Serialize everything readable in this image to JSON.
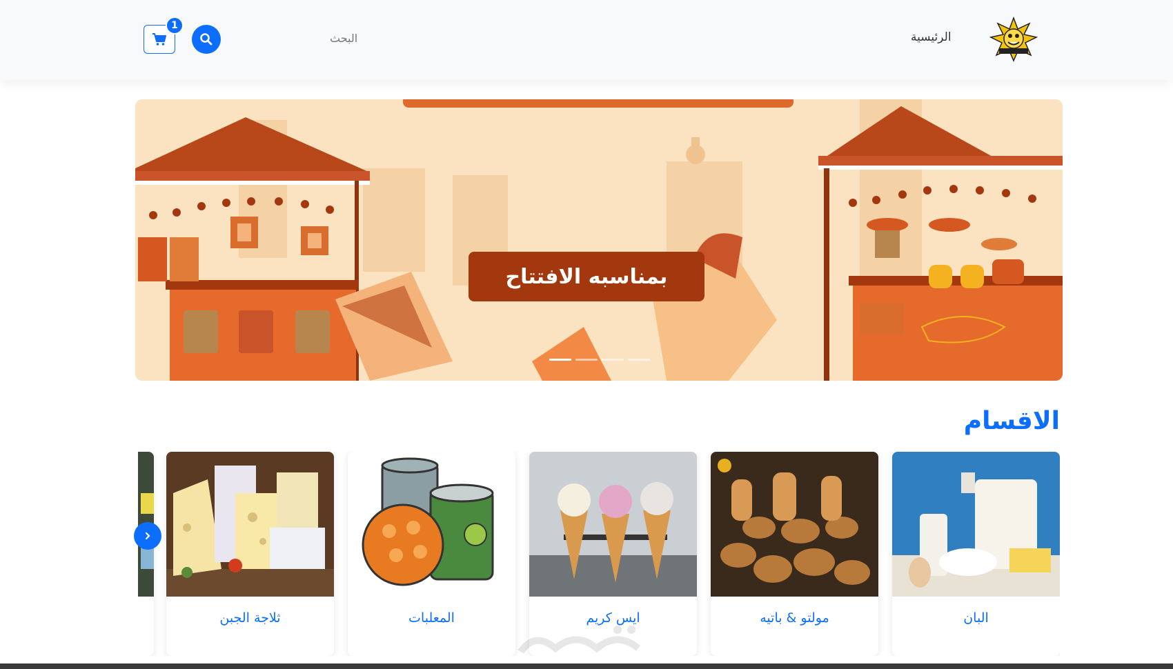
{
  "header": {
    "nav_home": "الرئيسية",
    "search_label": "البحث",
    "cart_count": "1",
    "colors": {
      "accent": "#0d6efd",
      "header_bg": "#f8f9fa"
    }
  },
  "banner": {
    "title": "بمناسبه الافتتاح",
    "slide_count": 4,
    "active_slide": 1,
    "colors": {
      "bg": "#fbe3c2",
      "title_bg": "#a3380f"
    }
  },
  "categories": {
    "title": "الاقسام",
    "items": [
      {
        "label": "البان",
        "image": "dairy-products"
      },
      {
        "label": "مولتو & باتيه",
        "image": "bakery-bread"
      },
      {
        "label": "ايس كريم",
        "image": "ice-cream-cones"
      },
      {
        "label": "المعلبات",
        "image": "canned-food"
      },
      {
        "label": "ثلاجة الجبن",
        "image": "cheese-assortment"
      },
      {
        "label": "",
        "image": "partial-card"
      }
    ]
  },
  "icons": {
    "search": "search-icon",
    "cart": "cart-icon",
    "prev": "chevron-right-icon"
  }
}
